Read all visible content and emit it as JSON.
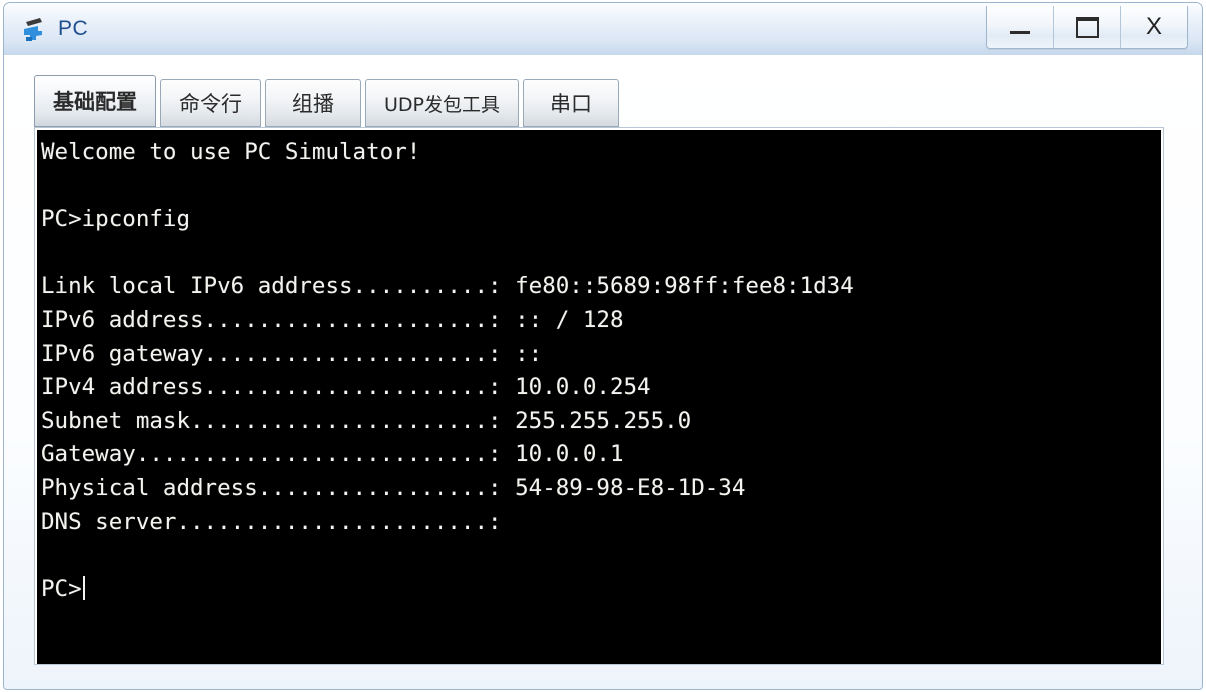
{
  "window": {
    "title": "PC",
    "icon": "pc-simulator-icon",
    "controls": [
      {
        "name": "minimize-button",
        "glyph": "minimize-icon",
        "label": "—"
      },
      {
        "name": "maximize-button",
        "glyph": "maximize-icon",
        "label": "▭"
      },
      {
        "name": "close-button",
        "glyph": "close-icon",
        "label": "X"
      }
    ]
  },
  "tabs": [
    {
      "label": "基础配置",
      "selected": true
    },
    {
      "label": "命令行",
      "selected": false
    },
    {
      "label": "组播",
      "selected": false
    },
    {
      "label": "UDP发包工具",
      "selected": false
    },
    {
      "label": "串口",
      "selected": false
    }
  ],
  "terminal": {
    "banner": "Welcome to use PC Simulator!",
    "prompt": "PC>",
    "command": "ipconfig",
    "dot_column": 33,
    "entries": [
      {
        "label": "Link local IPv6 address",
        "value": "fe80::5689:98ff:fee8:1d34"
      },
      {
        "label": "IPv6 address",
        "value": ":: / 128"
      },
      {
        "label": "IPv6 gateway",
        "value": "::"
      },
      {
        "label": "IPv4 address",
        "value": "10.0.0.254"
      },
      {
        "label": "Subnet mask",
        "value": "255.255.255.0"
      },
      {
        "label": "Gateway",
        "value": "10.0.0.1"
      },
      {
        "label": "Physical address",
        "value": "54-89-98-E8-1D-34"
      },
      {
        "label": "DNS server",
        "value": ""
      }
    ],
    "final_prompt": "PC>",
    "background_color": "#000000",
    "text_color": "#f3f3ef"
  }
}
